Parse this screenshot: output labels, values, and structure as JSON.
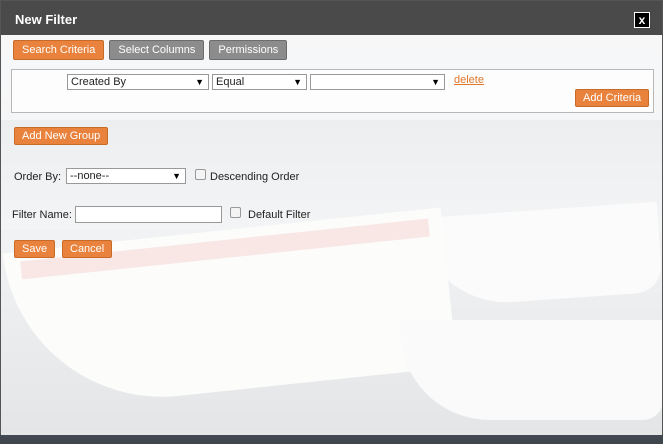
{
  "dialog": {
    "title": "New Filter",
    "close_label": "x"
  },
  "tabs": [
    {
      "label": "Search Criteria",
      "active": true
    },
    {
      "label": "Select Columns",
      "active": false
    },
    {
      "label": "Permissions",
      "active": false
    }
  ],
  "criteria": {
    "field": "Created By",
    "operator": "Equal",
    "value": "",
    "delete_label": "delete",
    "add_criteria_label": "Add Criteria"
  },
  "add_group_label": "Add New Group",
  "order_by": {
    "label": "Order By:",
    "value": "--none--",
    "descending_label": "Descending Order"
  },
  "filter_name": {
    "label": "Filter Name:",
    "value": "",
    "default_label": "Default Filter"
  },
  "actions": {
    "save_label": "Save",
    "cancel_label": "Cancel"
  },
  "colors": {
    "accent": "#e8823c",
    "tab_inactive": "#8c8c8c",
    "titlebar": "#4a4a4a"
  }
}
